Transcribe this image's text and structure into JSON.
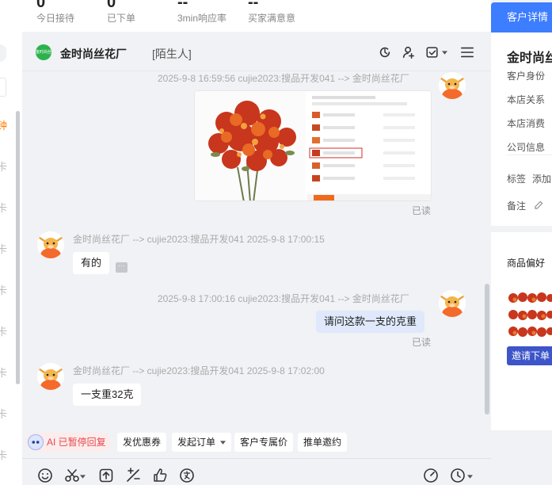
{
  "stats": [
    {
      "value": "0",
      "label": "今日接待"
    },
    {
      "value": "0",
      "label": "已下单"
    },
    {
      "value": "--",
      "label": "3min响应率"
    },
    {
      "value": "--",
      "label": "买家满意意"
    }
  ],
  "left_list": {
    "glyphs": [
      "钟",
      "卡",
      "卡",
      "卡",
      "卡",
      "卡",
      "卡",
      "卡",
      "卡",
      "卡"
    ]
  },
  "chat": {
    "shop_name": "金时尚丝花厂",
    "shop_tag": "[陌生人]",
    "logo_text": "金时尚丝花厂",
    "messages": {
      "m1": {
        "meta": "2025-9-8 16:59:56 cujie2023:搜品开发041 --> 金时尚丝花厂",
        "read": "已读"
      },
      "m2": {
        "meta": "金时尚丝花厂 --> cujie2023:搜品开发041   2025-9-8 17:00:15",
        "text": "有的"
      },
      "m3": {
        "meta": "2025-9-8 17:00:16 cujie2023:搜品开发041 --> 金时尚丝花厂",
        "text": "请问这款一支的克重",
        "read": "已读"
      },
      "m4": {
        "meta": "金时尚丝花厂 --> cujie2023:搜品开发041   2025-9-8 17:02:00",
        "text": "一支重32克"
      }
    },
    "more_label": "···"
  },
  "quick_actions": {
    "ai": "AI 已暂停回复",
    "coupon": "发优惠券",
    "order": "发起订单",
    "price": "客户专属价",
    "invite": "推单邀约"
  },
  "right_panel": {
    "tab": "客户详情",
    "customer_name": "金时尚丝",
    "rows": {
      "identity": "客户身份",
      "relation": "本店关系",
      "consume": "本店消费",
      "company": "公司信息",
      "tags": "标签",
      "add": "添加",
      "note": "备注"
    },
    "pref_title": "商品偏好",
    "invite_label": "邀请下单"
  },
  "colors": {
    "accent": "#3d7dff",
    "ai_red": "#e5484d",
    "bubble_out": "#dfe9fb"
  }
}
